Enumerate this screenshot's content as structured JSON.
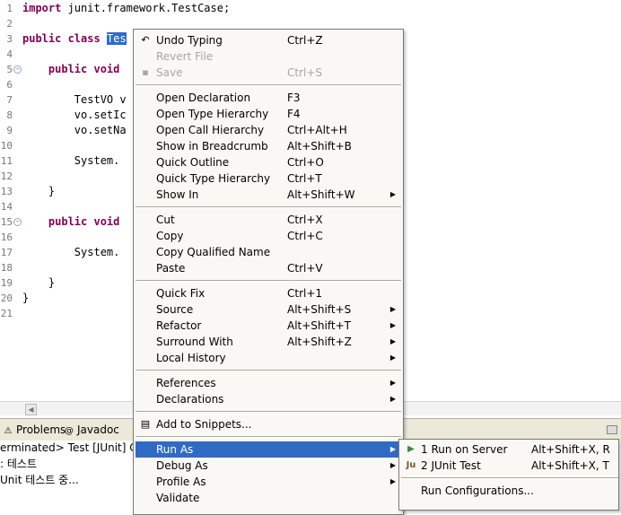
{
  "editor": {
    "lines": [
      {
        "n": "1",
        "pre": "",
        "kw": "import",
        "post": " junit.framework.TestCase;",
        "sel": "",
        "fold": false
      },
      {
        "n": "2",
        "pre": "",
        "kw": "",
        "post": "",
        "sel": "",
        "fold": false
      },
      {
        "n": "3",
        "pre": "",
        "kw": "public class",
        "post": " ",
        "sel": "Tes",
        "fold": false
      },
      {
        "n": "4",
        "pre": "",
        "kw": "",
        "post": "",
        "sel": "",
        "fold": false
      },
      {
        "n": "5",
        "pre": "    ",
        "kw": "public void",
        "post": "",
        "sel": "",
        "fold": true
      },
      {
        "n": "6",
        "pre": "",
        "kw": "",
        "post": "",
        "sel": "",
        "fold": false
      },
      {
        "n": "7",
        "pre": "        ",
        "kw": "",
        "post": "TestVO v",
        "sel": "",
        "fold": false
      },
      {
        "n": "8",
        "pre": "        ",
        "kw": "",
        "post": "vo.setIc",
        "sel": "",
        "fold": false
      },
      {
        "n": "9",
        "pre": "        ",
        "kw": "",
        "post": "vo.setNa",
        "sel": "",
        "fold": false
      },
      {
        "n": "10",
        "pre": "",
        "kw": "",
        "post": "",
        "sel": "",
        "fold": false
      },
      {
        "n": "11",
        "pre": "        ",
        "kw": "",
        "post": "System.",
        "sel": "",
        "fold": false
      },
      {
        "n": "12",
        "pre": "",
        "kw": "",
        "post": "",
        "sel": "",
        "fold": false
      },
      {
        "n": "13",
        "pre": "    ",
        "kw": "",
        "post": "}",
        "sel": "",
        "fold": false
      },
      {
        "n": "14",
        "pre": "",
        "kw": "",
        "post": "",
        "sel": "",
        "fold": false
      },
      {
        "n": "15",
        "pre": "    ",
        "kw": "public void",
        "post": "",
        "sel": "",
        "fold": true
      },
      {
        "n": "16",
        "pre": "",
        "kw": "",
        "post": "",
        "sel": "",
        "fold": false
      },
      {
        "n": "17",
        "pre": "        ",
        "kw": "",
        "post": "System.",
        "sel": "",
        "fold": false
      },
      {
        "n": "18",
        "pre": "",
        "kw": "",
        "post": "",
        "sel": "",
        "fold": false
      },
      {
        "n": "19",
        "pre": "    ",
        "kw": "",
        "post": "}",
        "sel": "",
        "fold": false
      },
      {
        "n": "20",
        "pre": "",
        "kw": "",
        "post": "}",
        "sel": "",
        "fold": false
      },
      {
        "n": "21",
        "pre": "",
        "kw": "",
        "post": "",
        "sel": "",
        "fold": false
      }
    ]
  },
  "panel": {
    "tabs": [
      {
        "label": "Problems",
        "icon": "problems-icon",
        "glyph": "⚠"
      },
      {
        "label": "Javadoc",
        "icon": "javadoc-icon",
        "glyph": "@"
      }
    ],
    "status": "erminated> Test [JUnit] C",
    "console_lines": [
      ": 테스트",
      "Unit 테스트 중..."
    ]
  },
  "context_menu": {
    "items": [
      {
        "type": "item",
        "label": "Undo Typing",
        "accel": "Ctrl+Z",
        "icon": "undo-icon",
        "glyph": "↶"
      },
      {
        "type": "item",
        "label": "Revert File",
        "accel": "",
        "disabled": true
      },
      {
        "type": "item",
        "label": "Save",
        "accel": "Ctrl+S",
        "disabled": true,
        "icon": "save-icon",
        "glyph": "▪"
      },
      {
        "type": "sep"
      },
      {
        "type": "item",
        "label": "Open Declaration",
        "accel": "F3"
      },
      {
        "type": "item",
        "label": "Open Type Hierarchy",
        "accel": "F4"
      },
      {
        "type": "item",
        "label": "Open Call Hierarchy",
        "accel": "Ctrl+Alt+H"
      },
      {
        "type": "item",
        "label": "Show in Breadcrumb",
        "accel": "Alt+Shift+B"
      },
      {
        "type": "item",
        "label": "Quick Outline",
        "accel": "Ctrl+O"
      },
      {
        "type": "item",
        "label": "Quick Type Hierarchy",
        "accel": "Ctrl+T"
      },
      {
        "type": "item",
        "label": "Show In",
        "accel": "Alt+Shift+W",
        "submenu": true
      },
      {
        "type": "sep"
      },
      {
        "type": "item",
        "label": "Cut",
        "accel": "Ctrl+X"
      },
      {
        "type": "item",
        "label": "Copy",
        "accel": "Ctrl+C"
      },
      {
        "type": "item",
        "label": "Copy Qualified Name",
        "accel": ""
      },
      {
        "type": "item",
        "label": "Paste",
        "accel": "Ctrl+V"
      },
      {
        "type": "sep"
      },
      {
        "type": "item",
        "label": "Quick Fix",
        "accel": "Ctrl+1"
      },
      {
        "type": "item",
        "label": "Source",
        "accel": "Alt+Shift+S",
        "submenu": true
      },
      {
        "type": "item",
        "label": "Refactor",
        "accel": "Alt+Shift+T",
        "submenu": true
      },
      {
        "type": "item",
        "label": "Surround With",
        "accel": "Alt+Shift+Z",
        "submenu": true
      },
      {
        "type": "item",
        "label": "Local History",
        "accel": "",
        "submenu": true
      },
      {
        "type": "sep"
      },
      {
        "type": "item",
        "label": "References",
        "accel": "",
        "submenu": true
      },
      {
        "type": "item",
        "label": "Declarations",
        "accel": "",
        "submenu": true
      },
      {
        "type": "sep"
      },
      {
        "type": "item",
        "label": "Add to Snippets...",
        "accel": "",
        "icon": "snippets-icon",
        "glyph": "▤"
      },
      {
        "type": "sep"
      },
      {
        "type": "item",
        "label": "Run As",
        "accel": "",
        "submenu": true,
        "highlight": true
      },
      {
        "type": "item",
        "label": "Debug As",
        "accel": "",
        "submenu": true
      },
      {
        "type": "item",
        "label": "Profile As",
        "accel": "",
        "submenu": true
      },
      {
        "type": "item",
        "label": "Validate",
        "accel": ""
      }
    ]
  },
  "run_as_submenu": {
    "items": [
      {
        "type": "item",
        "label": "1 Run on Server",
        "accel": "Alt+Shift+X, R",
        "icon": "run-on-server-icon",
        "glyph": "▶",
        "color": "#3a8a3a"
      },
      {
        "type": "item",
        "label": "2 JUnit Test",
        "accel": "Alt+Shift+X, T",
        "icon": "junit-icon",
        "glyph": "Ju",
        "color": "#7a5a2a"
      },
      {
        "type": "sep"
      },
      {
        "type": "item",
        "label": "Run Configurations...",
        "accel": ""
      }
    ]
  },
  "colors": {
    "selection": "#316ac5",
    "keyword": "#7f0055",
    "menu_bg": "#f9f8f4"
  }
}
